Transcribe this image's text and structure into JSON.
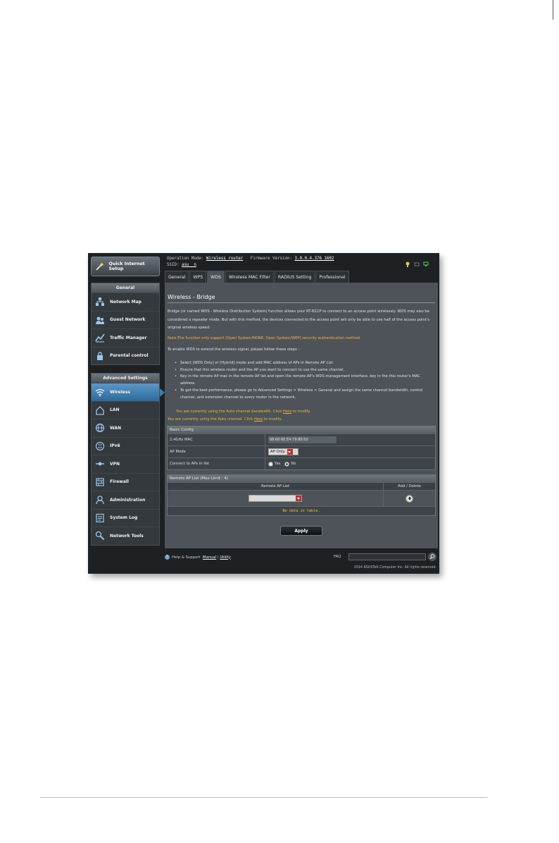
{
  "header": {
    "operation_mode_label": "Operation Mode:",
    "operation_mode_value": "Wireless router",
    "firmware_label": "Firmware Version:",
    "firmware_value": "3.0.0.4.376_1602",
    "ssid_label": "SSID:",
    "ssid_value": "asu    _n"
  },
  "sidebar": {
    "quick_setup": "Quick Internet Setup",
    "general_heading": "General",
    "general_items": [
      {
        "label": "Network Map",
        "icon": "network-map-icon"
      },
      {
        "label": "Guest Network",
        "icon": "guest-network-icon"
      },
      {
        "label": "Traffic Manager",
        "icon": "traffic-manager-icon"
      },
      {
        "label": "Parental control",
        "icon": "parental-control-icon"
      }
    ],
    "advanced_heading": "Advanced Settings",
    "advanced_items": [
      {
        "label": "Wireless",
        "icon": "wireless-icon"
      },
      {
        "label": "LAN",
        "icon": "lan-icon"
      },
      {
        "label": "WAN",
        "icon": "wan-icon"
      },
      {
        "label": "IPv6",
        "icon": "ipv6-icon"
      },
      {
        "label": "VPN",
        "icon": "vpn-icon"
      },
      {
        "label": "Firewall",
        "icon": "firewall-icon"
      },
      {
        "label": "Administration",
        "icon": "administration-icon"
      },
      {
        "label": "System Log",
        "icon": "system-log-icon"
      },
      {
        "label": "Network Tools",
        "icon": "network-tools-icon"
      }
    ]
  },
  "tabs": [
    "General",
    "WPS",
    "WDS",
    "Wireless MAC Filter",
    "RADIUS Setting",
    "Professional"
  ],
  "content": {
    "title": "Wireless - Bridge",
    "intro": "Bridge (or named WDS - Wireless Distribution System) function allows your RT-N11P to connect to an access point wirelessly. WDS may also be considered a repeater mode. But with this method, the devices connected to the access point will only be able to use half of the access point's original wireless speed.",
    "note": "Note:The function only support [Open System/NONE, Open System/WEP] security authentication method.",
    "steps_intro": "To enable WDS to extend the wireless signal, please follow these steps :",
    "steps": [
      "Select [WDS Only] or [Hybrid] mode and add MAC address of APs in Remote AP List.",
      "Ensure that this wireless router and the AP you want to connect to use the same channel.",
      "Key in the remote AP mac in the remote AP list and open the remote AP's WDS management interface, key in the this router's MAC address.",
      "To get the best performance, please go to Advanced Settings > Wireless > General and assign the same channel bandwidth, control channel, and extension channel to every router in the network."
    ],
    "notice1_prefix": "You are currently using the Auto channel bandwidth. Click ",
    "notice1_link": "Here",
    "notice1_suffix": " to modify.",
    "notice2_prefix": "You are currently using the Auto channel. Click ",
    "notice2_link": "Here",
    "notice2_suffix": " to modify."
  },
  "basic_config": {
    "heading": "Basic Config",
    "mac_label": "2.4GHz MAC",
    "mac_value": "08:60:6E:E4:79:80:50",
    "ap_mode_label": "AP Mode",
    "ap_mode_value": "AP Only",
    "connect_label": "Connect to APs in list",
    "yes_label": "Yes",
    "no_label": "No",
    "connect_selected": "No"
  },
  "remote_list": {
    "heading": "Remote AP List (Max Limit : 4)",
    "col_list": "Remote AP List",
    "col_action": "Add / Delete",
    "select_value": "",
    "empty_text": "No data in table."
  },
  "apply_label": "Apply",
  "footer": {
    "help": "Help & Support",
    "manual": "Manual",
    "separator": "|",
    "utility": "Utility",
    "faq": "FAQ",
    "copyright": "2014 ASUSTeK Computer Inc. All rights reserved."
  },
  "colors": {
    "accent_blue": "#3b7cb0",
    "notice_yellow": "#f2b63a",
    "panel_gray": "#4d5358"
  }
}
